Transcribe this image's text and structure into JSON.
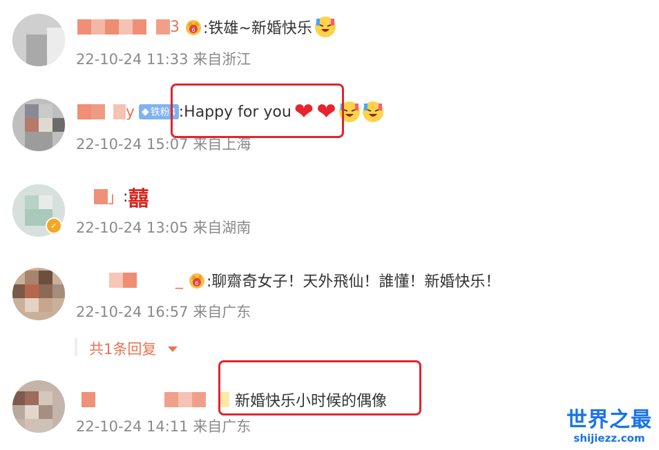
{
  "comments": [
    {
      "text": ":铁雄~新婚快乐",
      "time": "22-10-24 11:33",
      "location": "来自浙江",
      "name_suffix": "3"
    },
    {
      "text": ":Happy for you",
      "time": "22-10-24 15:07",
      "location": "来自上海",
      "name_suffix": "y",
      "fan_badge": "铁粉4"
    },
    {
      "text": ":",
      "time": "22-10-24 13:05",
      "location": "来自湖南",
      "name_suffix": "」",
      "emoji": "囍"
    },
    {
      "text": ":聊齋奇女子！天外飛仙！誰懂！新婚快乐！",
      "time": "22-10-24 16:57",
      "location": "来自广东",
      "name_suffix": "_"
    },
    {
      "text": "新婚快乐小时候的偶像",
      "time": "22-10-24 14:11",
      "location": "来自广东"
    }
  ],
  "reply_toggle": "共1条回复",
  "watermark": {
    "title": "世界之最",
    "url": "shijiezz.com"
  },
  "colors": {
    "accent": "#eb7350",
    "highlight": "#e0242a",
    "meta": "#8a8a8a"
  }
}
